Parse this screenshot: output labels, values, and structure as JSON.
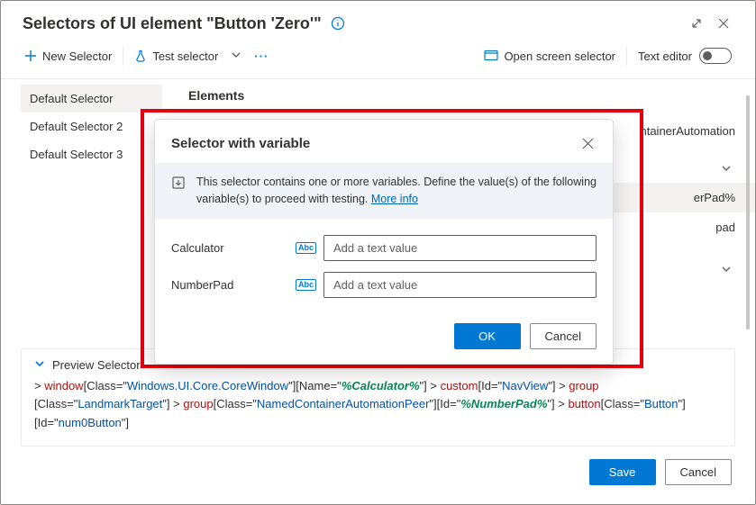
{
  "header": {
    "title": "Selectors of UI element \"Button 'Zero'\""
  },
  "toolbar": {
    "new_selector": "New Selector",
    "test_selector": "Test selector",
    "open_screen": "Open screen selector",
    "text_editor": "Text editor"
  },
  "sidebar": {
    "items": [
      {
        "label": "Default Selector",
        "selected": true
      },
      {
        "label": "Default Selector 2",
        "selected": false
      },
      {
        "label": "Default Selector 3",
        "selected": false
      }
    ]
  },
  "main": {
    "section_title": "Elements",
    "rows": [
      {
        "text": "ntainerAutomation",
        "alt": false
      },
      {
        "text": "",
        "alt": false
      },
      {
        "text": "erPad%",
        "alt": true
      },
      {
        "text": "pad",
        "alt": false
      },
      {
        "text": "",
        "alt": false
      }
    ]
  },
  "dialog": {
    "title": "Selector with variable",
    "banner": "This selector contains one or more variables. Define the value(s) of the following variable(s) to proceed with testing.",
    "more_info": "More info",
    "fields": [
      {
        "label": "Calculator",
        "placeholder": "Add a text value"
      },
      {
        "label": "NumberPad",
        "placeholder": "Add a text value"
      }
    ],
    "ok": "OK",
    "cancel": "Cancel"
  },
  "preview": {
    "title": "Preview Selector",
    "tokens": [
      {
        "t": "gt",
        "v": "> "
      },
      {
        "t": "el",
        "v": "window"
      },
      {
        "t": "plain",
        "v": "[Class=\""
      },
      {
        "t": "attrv",
        "v": "Windows.UI.Core.CoreWindow"
      },
      {
        "t": "plain",
        "v": "\"][Name=\""
      },
      {
        "t": "var",
        "v": "%Calculator%"
      },
      {
        "t": "plain",
        "v": "\"] "
      },
      {
        "t": "gt",
        "v": "> "
      },
      {
        "t": "el",
        "v": "custom"
      },
      {
        "t": "plain",
        "v": "[Id=\""
      },
      {
        "t": "attrv",
        "v": "NavView"
      },
      {
        "t": "plain",
        "v": "\"] "
      },
      {
        "t": "gt",
        "v": "> "
      },
      {
        "t": "el",
        "v": "group"
      },
      {
        "t": "plain",
        "v": " [Class=\""
      },
      {
        "t": "attrv",
        "v": "LandmarkTarget"
      },
      {
        "t": "plain",
        "v": "\"] "
      },
      {
        "t": "gt",
        "v": "> "
      },
      {
        "t": "el",
        "v": "group"
      },
      {
        "t": "plain",
        "v": "[Class=\""
      },
      {
        "t": "attrv",
        "v": "NamedContainerAutomationPeer"
      },
      {
        "t": "plain",
        "v": "\"][Id=\""
      },
      {
        "t": "var",
        "v": "%NumberPad%"
      },
      {
        "t": "plain",
        "v": "\"] "
      },
      {
        "t": "gt",
        "v": "> "
      },
      {
        "t": "el",
        "v": "button"
      },
      {
        "t": "plain",
        "v": "[Class=\""
      },
      {
        "t": "attrv",
        "v": "Button"
      },
      {
        "t": "plain",
        "v": "\"] [Id=\""
      },
      {
        "t": "attrv",
        "v": "num0Button"
      },
      {
        "t": "plain",
        "v": "\"]"
      }
    ]
  },
  "footer": {
    "save": "Save",
    "cancel": "Cancel"
  },
  "icons": {
    "abc": "Abc"
  }
}
